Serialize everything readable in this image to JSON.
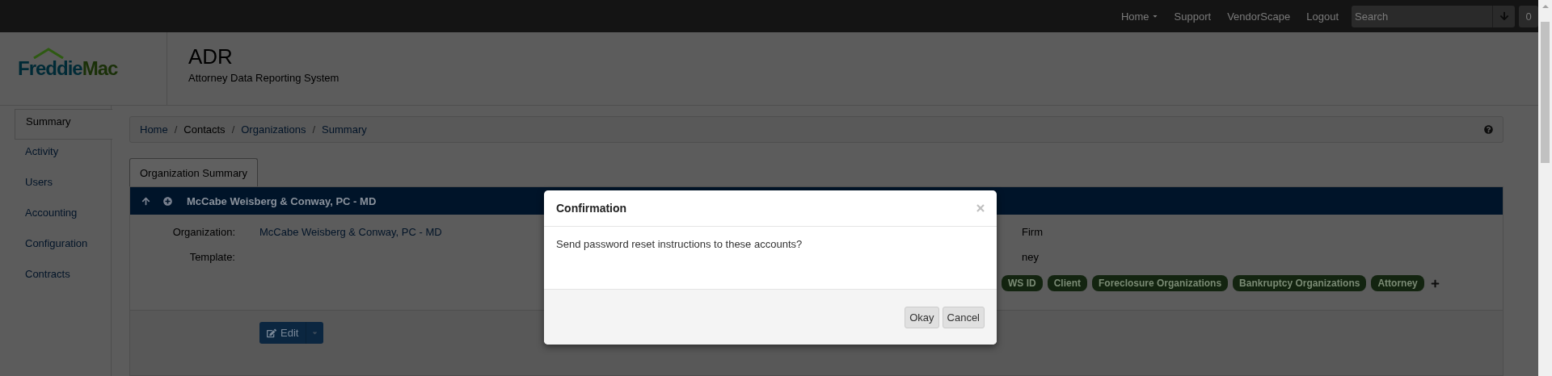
{
  "topnav": {
    "items": [
      {
        "label": "Home",
        "dropdown": true
      },
      {
        "label": "Support",
        "dropdown": false
      },
      {
        "label": "VendorScape",
        "dropdown": false
      },
      {
        "label": "Logout",
        "dropdown": false
      }
    ],
    "search": {
      "placeholder": "Search"
    },
    "badge": "0"
  },
  "logo": {
    "first": "Freddie",
    "second": "Mac"
  },
  "header": {
    "title": "ADR",
    "subtitle": "Attorney Data Reporting System"
  },
  "sidebar": {
    "items": [
      {
        "label": "Summary",
        "selected": true
      },
      {
        "label": "Activity",
        "selected": false
      },
      {
        "label": "Users",
        "selected": false
      },
      {
        "label": "Accounting",
        "selected": false
      },
      {
        "label": "Configuration",
        "selected": false
      },
      {
        "label": "Contracts",
        "selected": false
      }
    ]
  },
  "breadcrumb": [
    {
      "label": "Home",
      "link": true
    },
    {
      "label": "Contacts",
      "link": false
    },
    {
      "label": "Organizations",
      "link": true
    },
    {
      "label": "Summary",
      "link": true
    }
  ],
  "breadcrumb_separator": "/",
  "tabs": [
    {
      "label": "Organization Summary",
      "selected": true
    }
  ],
  "org_bar": {
    "title": "McCabe Weisberg & Conway, PC - MD"
  },
  "fields": [
    {
      "label": "Organization:",
      "value": "McCabe Weisberg & Conway, PC - MD",
      "right": "Firm"
    },
    {
      "label": "Template:",
      "right": "ney"
    }
  ],
  "tags": [
    "WS ID",
    "Client",
    "Foreclosure Organizations",
    "Bankruptcy Organizations",
    "Attorney"
  ],
  "edit_button": {
    "label": "Edit"
  },
  "modal": {
    "title": "Confirmation",
    "message": "Send password reset instructions to these accounts?",
    "buttons": [
      {
        "label": "Okay"
      },
      {
        "label": "Cancel"
      }
    ]
  }
}
